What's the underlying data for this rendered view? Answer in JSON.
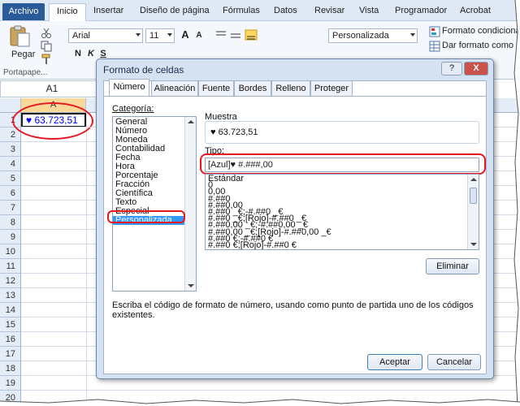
{
  "ribbon_tabs": {
    "archivo": "Archivo",
    "inicio": "Inicio",
    "insertar": "Insertar",
    "diseno": "Diseño de página",
    "formulas": "Fórmulas",
    "datos": "Datos",
    "revisar": "Revisar",
    "vista": "Vista",
    "programador": "Programador",
    "acrobat": "Acrobat"
  },
  "ribbon": {
    "paste_label": "Pegar",
    "clipboard_group": "Portapape...",
    "font_name": "Arial",
    "font_size": "11",
    "grow_font": "A",
    "shrink_font": "A",
    "bold": "N",
    "italic": "K",
    "underline": "S",
    "number_format": "Personalizada",
    "conditional_format": "Formato condiciona",
    "format_table": "Dar formato como"
  },
  "formula_bar": {
    "name_box": "A1"
  },
  "sheet": {
    "col_a": "A",
    "rows": [
      "1",
      "2",
      "3",
      "4",
      "5",
      "6",
      "7",
      "8",
      "9",
      "10",
      "11",
      "12",
      "13",
      "14",
      "15",
      "16",
      "17",
      "18",
      "19",
      "20"
    ],
    "a1_value": "♥ 63.723,51"
  },
  "dialog": {
    "title": "Formato de celdas",
    "help_btn": "?",
    "close_btn": "X",
    "tabs": {
      "numero": "Número",
      "alineacion": "Alineación",
      "fuente": "Fuente",
      "bordes": "Bordes",
      "relleno": "Relleno",
      "proteger": "Proteger"
    },
    "categoria_label": "Categoría:",
    "categories": [
      "General",
      "Número",
      "Moneda",
      "Contabilidad",
      "Fecha",
      "Hora",
      "Porcentaje",
      "Fracción",
      "Científica",
      "Texto",
      "Especial",
      "Personalizada"
    ],
    "selected_category": "Personalizada",
    "muestra_label": "Muestra",
    "muestra_value": "♥ 63.723,51",
    "tipo_label": "Tipo:",
    "tipo_value": "[Azul]♥ #.###,00",
    "formats": [
      "Estándar",
      "0",
      "0,00",
      "#.##0",
      "#.##0,00",
      "#.##0 _€;-#.##0 _€",
      "#.##0 _€;[Rojo]-#.##0 _€",
      "#.##0,00 _€;-#.##0,00 _€",
      "#.##0,00 _€;[Rojo]-#.##0,00 _€",
      "#.##0 €;-#.##0 €",
      "#.##0 €;[Rojo]-#.##0 €"
    ],
    "eliminar": "Eliminar",
    "description": "Escriba el código de formato de número, usando como punto de partida uno de los códigos existentes.",
    "aceptar": "Aceptar",
    "cancelar": "Cancelar"
  },
  "colors": {
    "accent_blue": "#2a5a9a",
    "selection": "#3399ff",
    "highlight_red": "#e8161f",
    "cell_text_blue": "#0000ff"
  }
}
